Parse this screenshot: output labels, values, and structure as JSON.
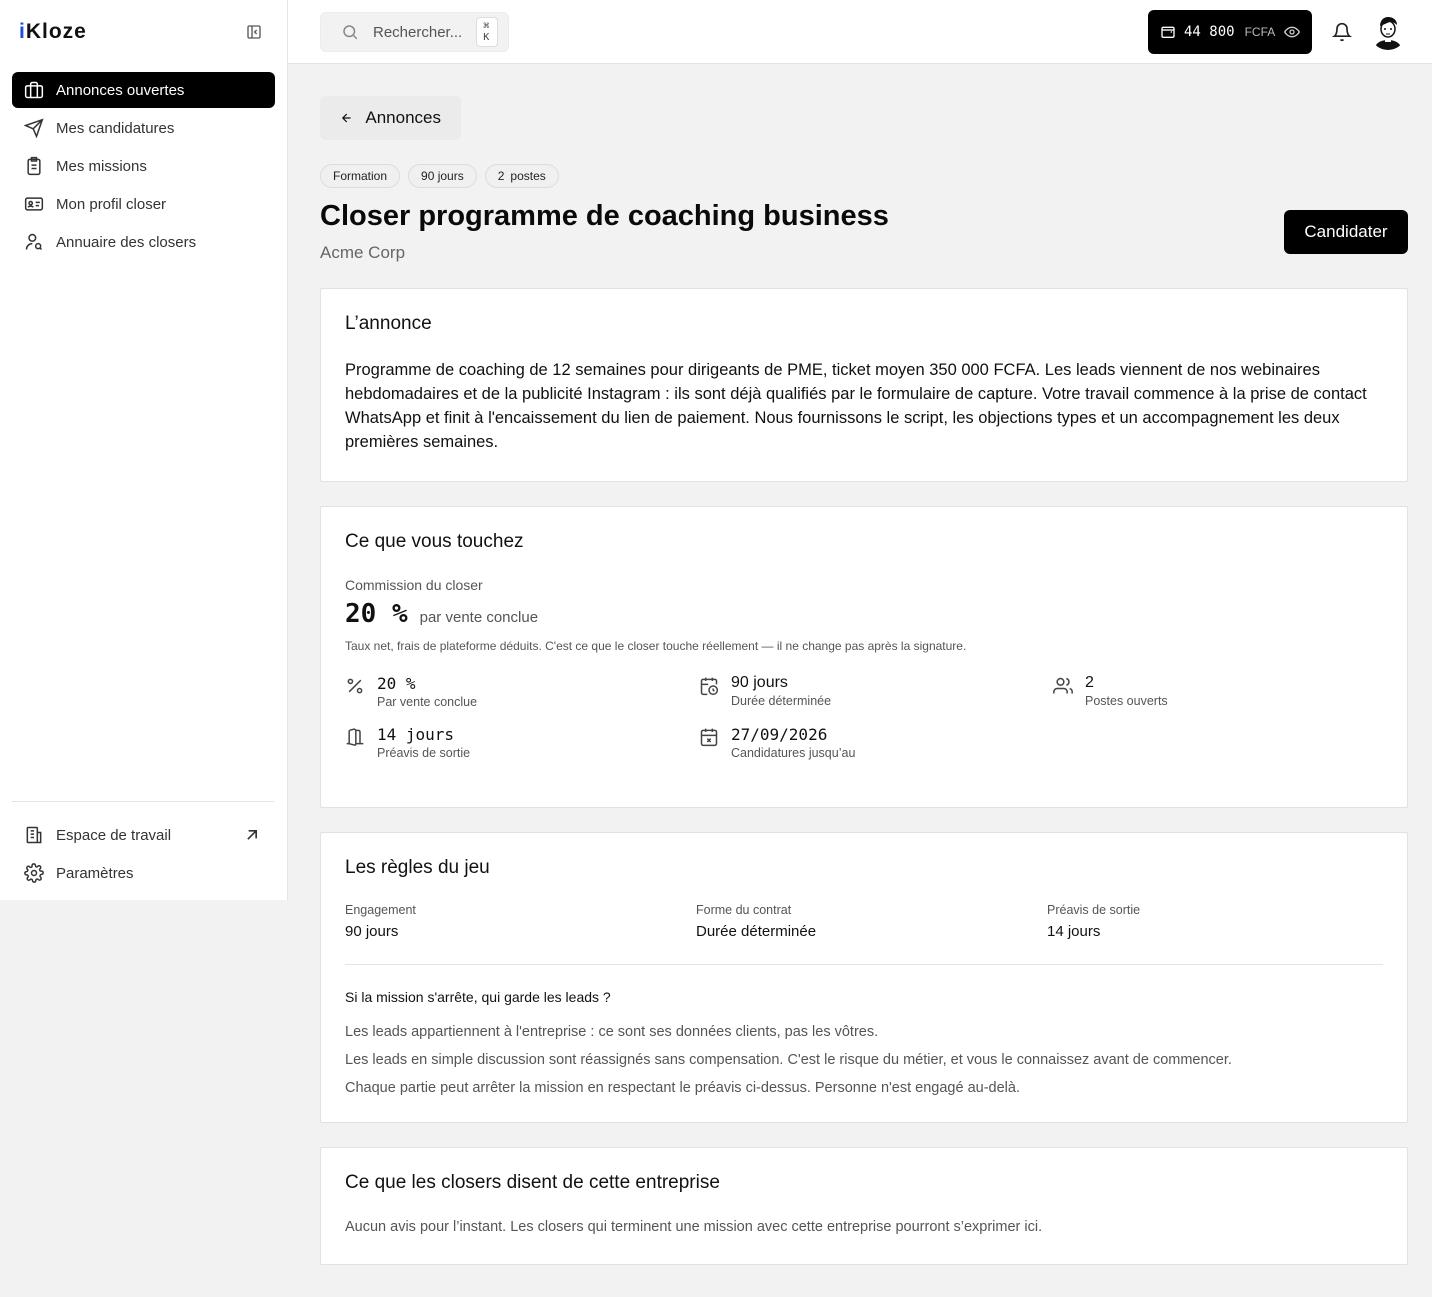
{
  "app": {
    "logo_prefix": "i",
    "logo_rest": "Kloze"
  },
  "sidebar": {
    "items": [
      {
        "label": "Annonces ouvertes",
        "icon": "briefcase-icon",
        "active": true
      },
      {
        "label": "Mes candidatures",
        "icon": "send-icon"
      },
      {
        "label": "Mes missions",
        "icon": "clipboard-list-icon"
      },
      {
        "label": "Mon profil closer",
        "icon": "id-card-icon"
      },
      {
        "label": "Annuaire des closers",
        "icon": "user-search-icon"
      }
    ],
    "bottom": [
      {
        "label": "Espace de travail",
        "icon": "building-icon",
        "external": true
      },
      {
        "label": "Paramètres",
        "icon": "gear-icon"
      }
    ]
  },
  "topbar": {
    "search_placeholder": "Rechercher...",
    "shortcut": "⌘ K",
    "wallet_amount": "44 800",
    "wallet_currency": "FCFA"
  },
  "page": {
    "back_label": "Annonces",
    "tags": [
      "Formation",
      "90 jours"
    ],
    "postes_count": "2",
    "postes_label": "postes",
    "title": "Closer programme de coaching business",
    "company": "Acme Corp",
    "apply_label": "Candidater"
  },
  "annonce": {
    "heading": "L’annonce",
    "text": "Programme de coaching de 12 semaines pour dirigeants de PME, ticket moyen 350 000 FCFA. Les leads viennent de nos webinaires hebdomadaires et de la publicité Instagram : ils sont déjà qualifiés par le formulaire de capture. Votre travail commence à la prise de contact WhatsApp et finit à l'encaissement du lien de paiement. Nous fournissons le script, les objections types et un accompagnement les deux premières semaines."
  },
  "remuneration": {
    "heading": "Ce que vous touchez",
    "commission_label": "Commission du closer",
    "commission_value": "20 %",
    "commission_suffix": "par vente conclue",
    "note": "Taux net, frais de plateforme déduits. C'est ce que le closer touche réellement — il ne change pas après la signature.",
    "stats": [
      {
        "value": "20 %",
        "label": "Par vente conclue",
        "icon": "percent-icon",
        "mono": true
      },
      {
        "value": "90 jours",
        "label": "Durée déterminée",
        "icon": "calendar-clock-icon",
        "mono": false
      },
      {
        "value": "2",
        "label": "Postes ouverts",
        "icon": "users-icon",
        "mono": false
      },
      {
        "value": "14 jours",
        "label": "Préavis de sortie",
        "icon": "door-open-icon",
        "mono": true
      },
      {
        "value": "27/09/2026",
        "label": "Candidatures jusqu’au",
        "icon": "calendar-x-icon",
        "mono": true
      }
    ]
  },
  "regles": {
    "heading": "Les règles du jeu",
    "items": [
      {
        "label": "Engagement",
        "value": "90 jours"
      },
      {
        "label": "Forme du contrat",
        "value": "Durée déterminée"
      },
      {
        "label": "Préavis de sortie",
        "value": "14 jours"
      }
    ],
    "question": "Si la mission s'arrête, qui garde les leads ?",
    "answers": [
      "Les leads appartiennent à l'entreprise : ce sont ses données clients, pas les vôtres.",
      "Les leads en simple discussion sont réassignés sans compensation. C'est le risque du métier, et vous le connaissez avant de commencer.",
      "Chaque partie peut arrêter la mission en respectant le préavis ci-dessus. Personne n'est engagé au-delà."
    ]
  },
  "avis": {
    "heading": "Ce que les closers disent de cette entreprise",
    "empty": "Aucun avis pour l’instant. Les closers qui terminent une mission avec cette entreprise pourront s’exprimer ici."
  }
}
